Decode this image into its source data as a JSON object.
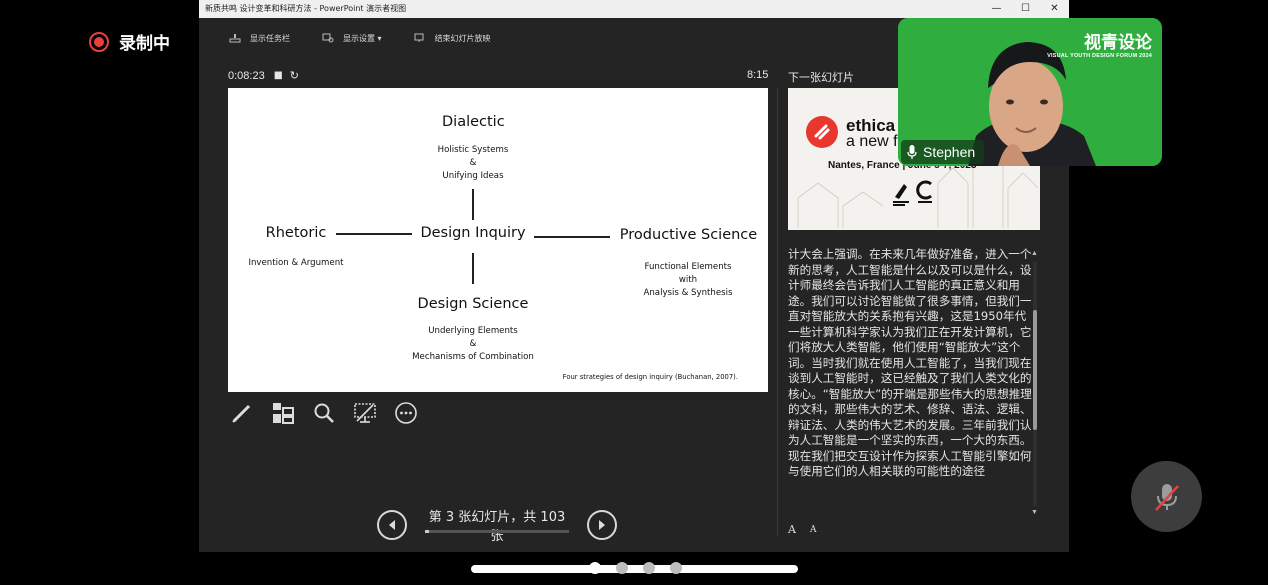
{
  "recording": {
    "label": "录制中"
  },
  "window": {
    "title": "新质共鸣 设计变革和科研方法 - PowerPoint 演示者视图",
    "minimize": "—",
    "maximize": "☐",
    "close": "✕"
  },
  "toolbar": {
    "show_taskbar": "显示任务栏",
    "display_settings": "显示设置 ▾",
    "end_show": "结束幻灯片放映"
  },
  "timer": {
    "elapsed": "0:08:23",
    "clock": "8:15"
  },
  "slide": {
    "dialectic": "Dialectic",
    "dialectic_sub1": "Holistic Systems",
    "dialectic_sub2": "&",
    "dialectic_sub3": "Unifying Ideas",
    "rhetoric": "Rhetoric",
    "rhetoric_sub": "Invention & Argument",
    "design_inquiry": "Design Inquiry",
    "productive": "Productive Science",
    "productive_sub1": "Functional Elements",
    "productive_sub2": "with",
    "productive_sub3": "Analysis & Synthesis",
    "design_science": "Design Science",
    "design_science_sub1": "Underlying Elements",
    "design_science_sub2": "&",
    "design_science_sub3": "Mechanisms of Combination",
    "citation": "Four strategies of design inquiry (Buchanan, 2007)."
  },
  "tools": [
    "pen-icon",
    "slides-grid-icon",
    "zoom-icon",
    "black-screen-icon",
    "more-icon"
  ],
  "navigation": {
    "label": "第 3 张幻灯片，共 103 张",
    "progress": 0.03
  },
  "next_slide": {
    "label": "下一张幻灯片",
    "title": "ethica",
    "subtitle": "a new f",
    "location": "Nantes, France | June 5-7, 2023"
  },
  "notes": {
    "text": "计大会上强调。在未来几年做好准备，进入一个新的思考，人工智能是什么以及可以是什么，设计师最终会告诉我们人工智能的真正意义和用途。我们可以讨论智能做了很多事情，但我们一直对智能放大的关系抱有兴趣，这是1950年代一些计算机科学家认为我们正在开发计算机，它们将放大人类智能，他们使用“智能放大”这个词。当时我们就在使用人工智能了，当我们现在谈到人工智能时，这已经触及了我们人类文化的核心。“智能放大”的开端是那些伟大的思想推理的文科，那些伟大的艺术、修辞、语法、逻辑、辩证法、人类的伟大艺术的发展。三年前我们认为人工智能是一个坚实的东西，一个大的东西。现在我们把交互设计作为探索人工智能引擎如何与使用它们的人相关联的可能性的途径"
  },
  "font_controls": {
    "increase": "A",
    "decrease": "A"
  },
  "webcam": {
    "participant": "Stephen",
    "logo_cn": "视青设论",
    "logo_en": "VISUAL YOUTH DESIGN FORUM 2024"
  },
  "colors": {
    "accent_red": "#e8372c",
    "webcam_green": "#2fae3f",
    "record_red": "#e84040"
  }
}
